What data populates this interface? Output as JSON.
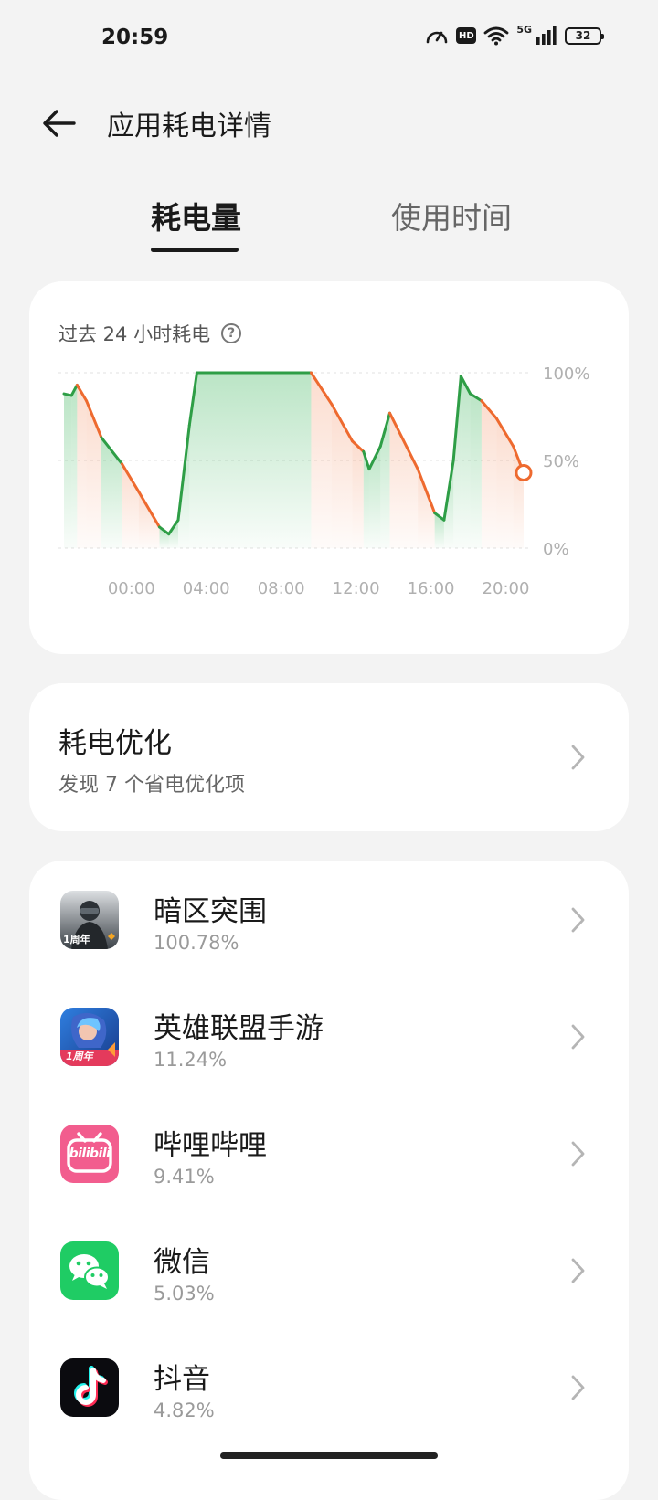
{
  "status_bar": {
    "time": "20:59",
    "network": "5G",
    "battery": "32",
    "hd": "HD",
    "icons": [
      "speed-icon",
      "hd-icon",
      "wifi-icon",
      "signal-icon",
      "battery-icon"
    ]
  },
  "header": {
    "title": "应用耗电详情"
  },
  "tabs": [
    {
      "label": "耗电量",
      "active": true
    },
    {
      "label": "使用时间",
      "active": false
    }
  ],
  "chart_card": {
    "title": "过去 24 小时耗电",
    "y_ticks": [
      "100%",
      "50%",
      "0%"
    ],
    "x_ticks": [
      "00:00",
      "04:00",
      "08:00",
      "12:00",
      "16:00",
      "20:00"
    ]
  },
  "chart_data": {
    "type": "line",
    "title": "过去 24 小时耗电",
    "xlabel": "",
    "ylabel": "",
    "ylim": [
      0,
      100
    ],
    "xlim": [
      -3.6,
      21.0
    ],
    "x_ticks": [
      0,
      4,
      8,
      12,
      16,
      20
    ],
    "x_tick_labels": [
      "00:00",
      "04:00",
      "08:00",
      "12:00",
      "16:00",
      "20:00"
    ],
    "y_tick_labels": [
      "0%",
      "50%",
      "100%"
    ],
    "grid": true,
    "colors": {
      "charging": "#2e9e46",
      "discharging": "#ee6a2f"
    },
    "points": [
      {
        "t": -3.6,
        "level": 88,
        "state": "charging"
      },
      {
        "t": -3.2,
        "level": 87,
        "state": "charging"
      },
      {
        "t": -2.9,
        "level": 93,
        "state": "charging"
      },
      {
        "t": -2.4,
        "level": 84,
        "state": "discharging"
      },
      {
        "t": -1.6,
        "level": 63,
        "state": "discharging"
      },
      {
        "t": -0.5,
        "level": 48,
        "state": "charging"
      },
      {
        "t": 0.4,
        "level": 32,
        "state": "discharging"
      },
      {
        "t": 1.5,
        "level": 12,
        "state": "discharging"
      },
      {
        "t": 2.0,
        "level": 8,
        "state": "charging"
      },
      {
        "t": 2.5,
        "level": 16,
        "state": "charging"
      },
      {
        "t": 3.1,
        "level": 70,
        "state": "charging"
      },
      {
        "t": 3.5,
        "level": 100,
        "state": "charging"
      },
      {
        "t": 9.6,
        "level": 100,
        "state": "charging"
      },
      {
        "t": 10.7,
        "level": 82,
        "state": "discharging"
      },
      {
        "t": 11.8,
        "level": 61,
        "state": "discharging"
      },
      {
        "t": 12.4,
        "level": 55,
        "state": "discharging"
      },
      {
        "t": 12.7,
        "level": 45,
        "state": "charging"
      },
      {
        "t": 13.3,
        "level": 58,
        "state": "charging"
      },
      {
        "t": 13.8,
        "level": 77,
        "state": "charging"
      },
      {
        "t": 15.3,
        "level": 45,
        "state": "discharging"
      },
      {
        "t": 16.2,
        "level": 20,
        "state": "discharging"
      },
      {
        "t": 16.7,
        "level": 16,
        "state": "charging"
      },
      {
        "t": 17.2,
        "level": 50,
        "state": "charging"
      },
      {
        "t": 17.6,
        "level": 98,
        "state": "charging"
      },
      {
        "t": 18.1,
        "level": 88,
        "state": "charging"
      },
      {
        "t": 18.7,
        "level": 84,
        "state": "charging"
      },
      {
        "t": 19.5,
        "level": 74,
        "state": "discharging"
      },
      {
        "t": 20.4,
        "level": 58,
        "state": "discharging"
      },
      {
        "t": 20.95,
        "level": 43,
        "state": "discharging"
      }
    ],
    "current": {
      "t": 20.95,
      "level": 43
    }
  },
  "optimization": {
    "title": "耗电优化",
    "subtitle": "发现 7 个省电优化项"
  },
  "apps": [
    {
      "name": "暗区突围",
      "percent": "100.78%",
      "icon": "game-icon",
      "badge": "1周年"
    },
    {
      "name": "英雄联盟手游",
      "percent": "11.24%",
      "icon": "game-icon",
      "badge": "1周年"
    },
    {
      "name": "哔哩哔哩",
      "percent": "9.41%",
      "icon": "bilibili-icon",
      "badge": "bilibili"
    },
    {
      "name": "微信",
      "percent": "5.03%",
      "icon": "wechat-icon",
      "badge": ""
    },
    {
      "name": "抖音",
      "percent": "4.82%",
      "icon": "tiktok-icon",
      "badge": ""
    }
  ]
}
